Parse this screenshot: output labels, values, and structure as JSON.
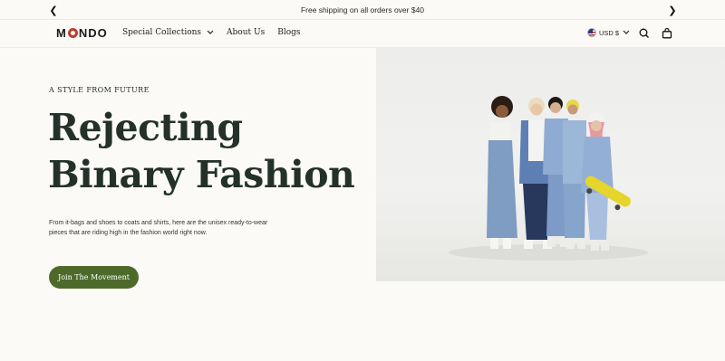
{
  "announcement": {
    "text": "Free shipping on all orders over $40",
    "prev_icon": "chevron-left-icon",
    "next_icon": "chevron-right-icon"
  },
  "header": {
    "logo_left": "M",
    "logo_right": "NDO",
    "nav": [
      {
        "label": "Special Collections",
        "has_dropdown": true
      },
      {
        "label": "About Us",
        "has_dropdown": false
      },
      {
        "label": "Blogs",
        "has_dropdown": false
      }
    ],
    "currency": "USD $",
    "icons": [
      "us-flag-icon",
      "search-icon",
      "shopping-bag-icon"
    ]
  },
  "hero": {
    "eyebrow": "A STYLE FROM FUTURE",
    "headline": "Rejecting Binary Fashion",
    "description": "From it-bags and shoes to coats and shirts, here are the unisex ready-to-wear pieces that are riding high in the fashion world right now.",
    "cta_label": "Join The Movement",
    "image_subject": "group of five models in denim outfits, one holding a yellow skateboard"
  },
  "colors": {
    "background": "#fbfaf7",
    "headline": "#24312b",
    "cta": "#4d6a2a",
    "logo_accent": "#b8402f",
    "skateboard": "#e6d52a"
  }
}
